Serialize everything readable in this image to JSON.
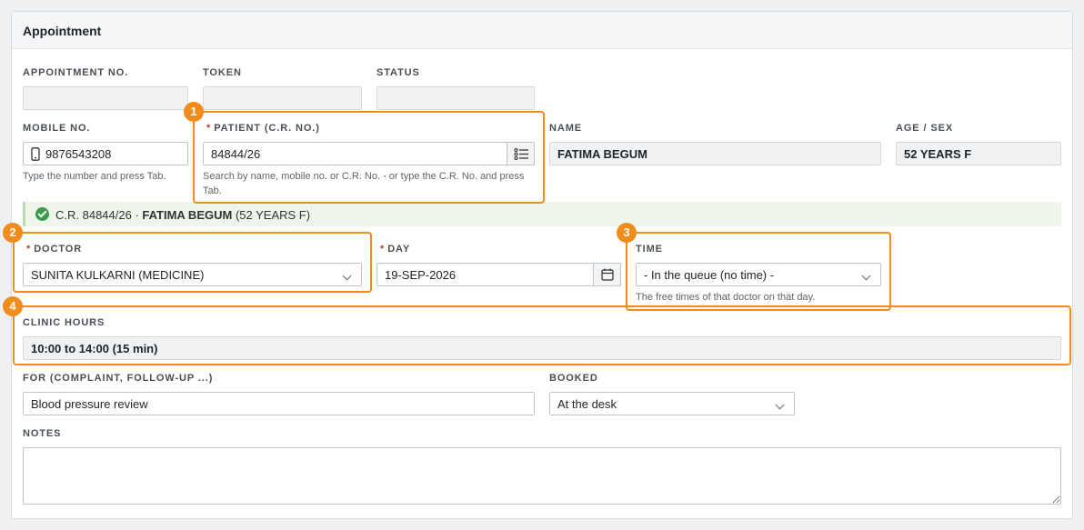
{
  "panel": {
    "title": "Appointment"
  },
  "fields": {
    "appointment_no": {
      "label": "APPOINTMENT NO.",
      "value": ""
    },
    "token": {
      "label": "TOKEN",
      "value": ""
    },
    "status": {
      "label": "STATUS",
      "value": ""
    },
    "mobile": {
      "label": "MOBILE NO.",
      "value": "9876543208",
      "help": "Type the number and press Tab.",
      "icon": "phone-icon"
    },
    "patient": {
      "label": "PATIENT (C.R. NO.)",
      "required_mark": "*",
      "value": "84844/26",
      "help": "Search by name, mobile no. or C.R. No. - or type the C.R. No. and press Tab.",
      "icon": "list-search-icon"
    },
    "name": {
      "label": "NAME",
      "value": "FATIMA BEGUM"
    },
    "age_sex": {
      "label": "AGE / SEX",
      "value": "52 YEARS F"
    },
    "doctor": {
      "label": "DOCTOR",
      "required_mark": "*",
      "value": "SUNITA KULKARNI (MEDICINE)"
    },
    "day": {
      "label": "DAY",
      "required_mark": "*",
      "value": "19-SEP-2026",
      "icon": "calendar-icon"
    },
    "time": {
      "label": "TIME",
      "value": "- In the queue (no time) -",
      "help": "The free times of that doctor on that day."
    },
    "clinic_hours": {
      "label": "CLINIC HOURS",
      "value": "10:00 to 14:00 (15 min)"
    },
    "for": {
      "label": "FOR (COMPLAINT, FOLLOW-UP ...)",
      "value": "Blood pressure review"
    },
    "booked": {
      "label": "BOOKED",
      "value": "At the desk"
    },
    "notes": {
      "label": "NOTES",
      "value": ""
    }
  },
  "confirmation": {
    "prefix": "C.R. 84844/26 · ",
    "name": "FATIMA BEGUM",
    "suffix": " (52 YEARS F)",
    "icon": "check-circle-icon",
    "color": "#3c9a4c"
  },
  "callouts": [
    "1",
    "2",
    "3",
    "4"
  ],
  "colors": {
    "highlight": "#f08c1c",
    "required": "#c0392b"
  }
}
